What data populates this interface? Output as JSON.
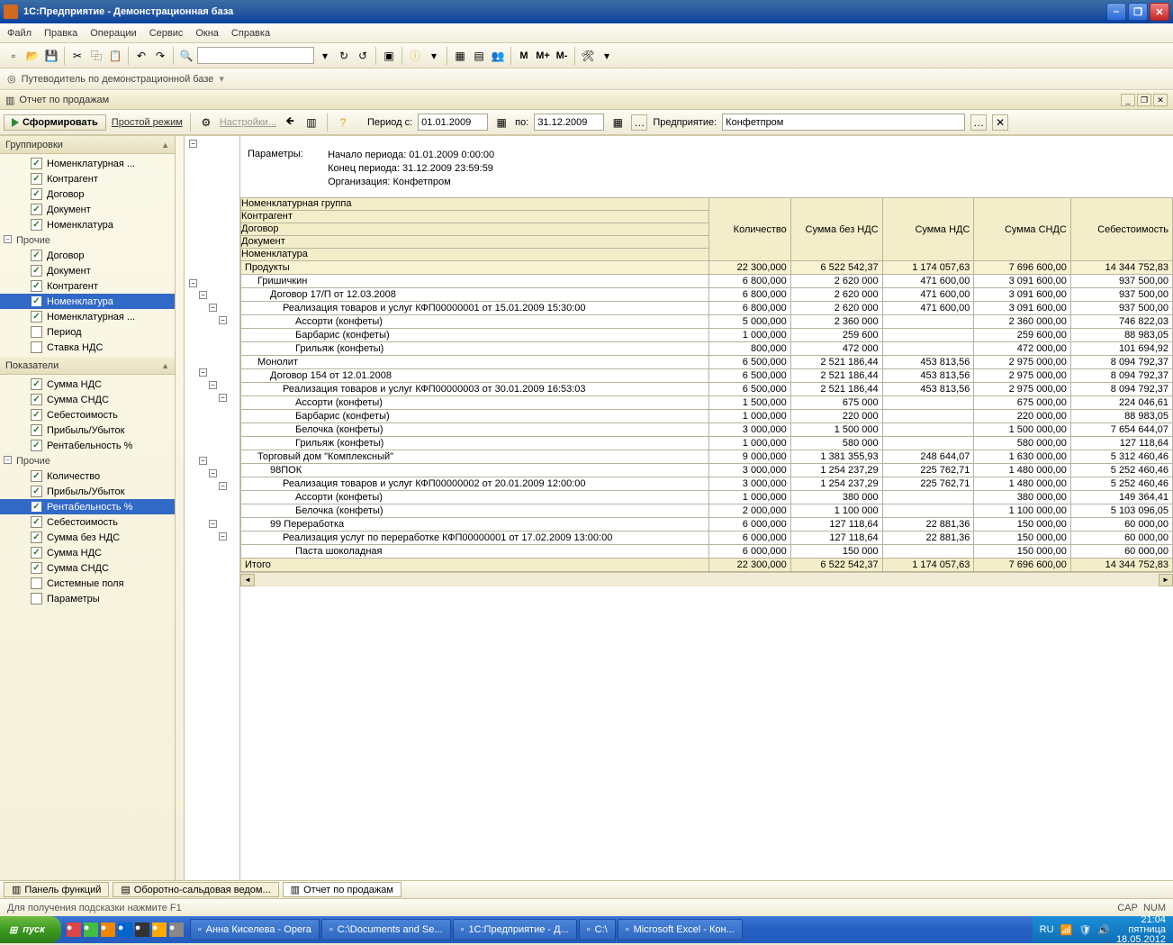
{
  "title": "1С:Предприятие - Демонстрационная база",
  "menu": [
    "Файл",
    "Правка",
    "Операции",
    "Сервис",
    "Окна",
    "Справка"
  ],
  "guide": "Путеводитель по демонстрационной базе",
  "report": {
    "title": "Отчет по продажам",
    "form_btn": "Сформировать",
    "simple_mode": "Простой режим",
    "settings": "Настройки...",
    "period_label": "Период с:",
    "to_label": "по:",
    "enterprise_label": "Предприятие:",
    "date_from": "01.01.2009",
    "date_to": "31.12.2009",
    "enterprise": "Конфетпром"
  },
  "left": {
    "groupings": "Группировки",
    "groupings_items": [
      {
        "label": "Номенклатурная ...",
        "checked": true
      },
      {
        "label": "Контрагент",
        "checked": true
      },
      {
        "label": "Договор",
        "checked": true
      },
      {
        "label": "Документ",
        "checked": true
      },
      {
        "label": "Номенклатура",
        "checked": true
      }
    ],
    "others1": "Прочие",
    "others1_items": [
      {
        "label": "Договор",
        "checked": true
      },
      {
        "label": "Документ",
        "checked": true
      },
      {
        "label": "Контрагент",
        "checked": true
      },
      {
        "label": "Номенклатура",
        "checked": true,
        "sel": true
      },
      {
        "label": "Номенклатурная ...",
        "checked": true
      },
      {
        "label": "Период",
        "checked": false
      },
      {
        "label": "Ставка НДС",
        "checked": false
      }
    ],
    "indicators": "Показатели",
    "indicators_items": [
      {
        "label": "Сумма НДС",
        "checked": true
      },
      {
        "label": "Сумма СНДС",
        "checked": true
      },
      {
        "label": "Себестоимость",
        "checked": true
      },
      {
        "label": "Прибыль/Убыток",
        "checked": true
      },
      {
        "label": "Рентабельность %",
        "checked": true
      }
    ],
    "others2": "Прочие",
    "others2_items": [
      {
        "label": "Количество",
        "checked": true
      },
      {
        "label": "Прибыль/Убыток",
        "checked": true
      },
      {
        "label": "Рентабельность %",
        "checked": true,
        "sel": true
      },
      {
        "label": "Себестоимость",
        "checked": true
      },
      {
        "label": "Сумма без НДС",
        "checked": true
      },
      {
        "label": "Сумма НДС",
        "checked": true
      },
      {
        "label": "Сумма СНДС",
        "checked": true
      },
      {
        "label": "Системные поля",
        "checked": false
      },
      {
        "label": "Параметры",
        "checked": false
      }
    ]
  },
  "params": {
    "label": "Параметры:",
    "l1": "Начало периода: 01.01.2009 0:00:00",
    "l2": "Конец периода: 31.12.2009 23:59:59",
    "l3": "Организация: Конфетпром"
  },
  "headers": {
    "rowheaders": [
      "Номенклатурная группа",
      "Контрагент",
      "Договор",
      "Документ",
      "Номенклатура"
    ],
    "cols": [
      "Количество",
      "Сумма без НДС",
      "Сумма НДС",
      "Сумма СНДС",
      "Себестоимость"
    ]
  },
  "rows": [
    {
      "lvl": 0,
      "label": "Продукты",
      "v": [
        "22 300,000",
        "6 522 542,37",
        "1 174 057,63",
        "7 696 600,00",
        "14 344 752,83"
      ]
    },
    {
      "lvl": 1,
      "label": "Гришичкин",
      "v": [
        "6 800,000",
        "2 620 000",
        "471 600,00",
        "3 091 600,00",
        "937 500,00"
      ]
    },
    {
      "lvl": 2,
      "label": "Договор 17/П от 12.03.2008",
      "v": [
        "6 800,000",
        "2 620 000",
        "471 600,00",
        "3 091 600,00",
        "937 500,00"
      ]
    },
    {
      "lvl": 3,
      "label": "Реализация товаров и услуг КФП00000001 от 15.01.2009 15:30:00",
      "v": [
        "6 800,000",
        "2 620 000",
        "471 600,00",
        "3 091 600,00",
        "937 500,00"
      ]
    },
    {
      "lvl": 4,
      "label": "Ассорти (конфеты)",
      "v": [
        "5 000,000",
        "2 360 000",
        "",
        "2 360 000,00",
        "746 822,03"
      ]
    },
    {
      "lvl": 4,
      "label": "Барбарис (конфеты)",
      "v": [
        "1 000,000",
        "259 600",
        "",
        "259 600,00",
        "88 983,05"
      ]
    },
    {
      "lvl": 4,
      "label": "Грильяж (конфеты)",
      "v": [
        "800,000",
        "472 000",
        "",
        "472 000,00",
        "101 694,92"
      ]
    },
    {
      "lvl": 1,
      "label": "Монолит",
      "v": [
        "6 500,000",
        "2 521 186,44",
        "453 813,56",
        "2 975 000,00",
        "8 094 792,37"
      ]
    },
    {
      "lvl": 2,
      "label": "Договор 154 от 12.01.2008",
      "v": [
        "6 500,000",
        "2 521 186,44",
        "453 813,56",
        "2 975 000,00",
        "8 094 792,37"
      ]
    },
    {
      "lvl": 3,
      "label": "Реализация товаров и услуг КФП00000003 от 30.01.2009 16:53:03",
      "v": [
        "6 500,000",
        "2 521 186,44",
        "453 813,56",
        "2 975 000,00",
        "8 094 792,37"
      ]
    },
    {
      "lvl": 4,
      "label": "Ассорти (конфеты)",
      "v": [
        "1 500,000",
        "675 000",
        "",
        "675 000,00",
        "224 046,61"
      ]
    },
    {
      "lvl": 4,
      "label": "Барбарис (конфеты)",
      "v": [
        "1 000,000",
        "220 000",
        "",
        "220 000,00",
        "88 983,05"
      ]
    },
    {
      "lvl": 4,
      "label": "Белочка (конфеты)",
      "v": [
        "3 000,000",
        "1 500 000",
        "",
        "1 500 000,00",
        "7 654 644,07"
      ]
    },
    {
      "lvl": 4,
      "label": "Грильяж (конфеты)",
      "v": [
        "1 000,000",
        "580 000",
        "",
        "580 000,00",
        "127 118,64"
      ]
    },
    {
      "lvl": 1,
      "label": "Торговый дом \"Комплексный\"",
      "v": [
        "9 000,000",
        "1 381 355,93",
        "248 644,07",
        "1 630 000,00",
        "5 312 460,46"
      ]
    },
    {
      "lvl": 2,
      "label": "98ПОК",
      "v": [
        "3 000,000",
        "1 254 237,29",
        "225 762,71",
        "1 480 000,00",
        "5 252 460,46"
      ]
    },
    {
      "lvl": 3,
      "label": "Реализация товаров и услуг КФП00000002 от 20.01.2009 12:00:00",
      "v": [
        "3 000,000",
        "1 254 237,29",
        "225 762,71",
        "1 480 000,00",
        "5 252 460,46"
      ]
    },
    {
      "lvl": 4,
      "label": "Ассорти (конфеты)",
      "v": [
        "1 000,000",
        "380 000",
        "",
        "380 000,00",
        "149 364,41"
      ]
    },
    {
      "lvl": 4,
      "label": "Белочка (конфеты)",
      "v": [
        "2 000,000",
        "1 100 000",
        "",
        "1 100 000,00",
        "5 103 096,05"
      ]
    },
    {
      "lvl": 2,
      "label": "99 Переработка",
      "v": [
        "6 000,000",
        "127 118,64",
        "22 881,36",
        "150 000,00",
        "60 000,00"
      ]
    },
    {
      "lvl": 3,
      "label": "Реализация услуг по переработке КФП00000001 от 17.02.2009 13:00:00",
      "v": [
        "6 000,000",
        "127 118,64",
        "22 881,36",
        "150 000,00",
        "60 000,00"
      ]
    },
    {
      "lvl": 4,
      "label": "Паста шоколадная",
      "v": [
        "6 000,000",
        "150 000",
        "",
        "150 000,00",
        "60 000,00"
      ]
    }
  ],
  "total": {
    "label": "Итого",
    "v": [
      "22 300,000",
      "6 522 542,37",
      "1 174 057,63",
      "7 696 600,00",
      "14 344 752,83"
    ]
  },
  "tabs": {
    "panel": "Панель функций",
    "t1": "Оборотно-сальдовая ведом...",
    "t2": "Отчет по продажам"
  },
  "status": {
    "hint": "Для получения подсказки нажмите F1",
    "cap": "CAP",
    "num": "NUM"
  },
  "taskbar": {
    "start": "пуск",
    "lang": "RU",
    "items": [
      "Анна Киселева - Opera",
      "C:\\Documents and Se...",
      "1С:Предприятие - Д...",
      "C:\\",
      "Microsoft Excel - Кон..."
    ],
    "time": "21:04",
    "day": "пятница",
    "date": "18.05.2012"
  }
}
